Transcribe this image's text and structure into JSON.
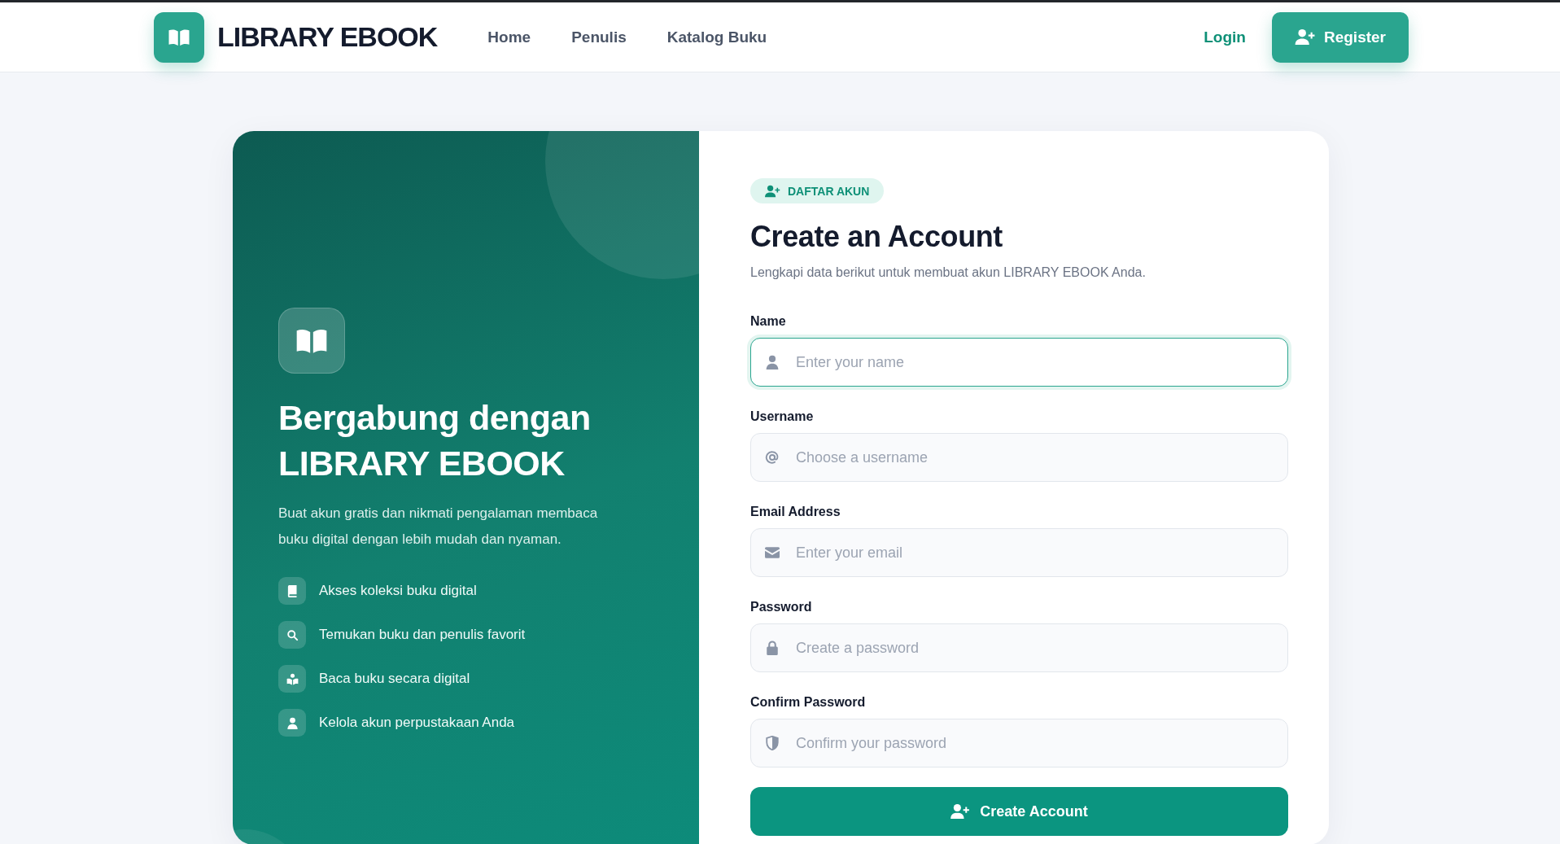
{
  "header": {
    "brand": "LIBRARY EBOOK",
    "nav": [
      "Home",
      "Penulis",
      "Katalog Buku"
    ],
    "login": "Login",
    "register": "Register"
  },
  "promo": {
    "heading": "Bergabung dengan LIBRARY EBOOK",
    "text": "Buat akun gratis dan nikmati pengalaman membaca buku digital dengan lebih mudah dan nyaman.",
    "features": [
      "Akses koleksi buku digital",
      "Temukan buku dan penulis favorit",
      "Baca buku secara digital",
      "Kelola akun perpustakaan Anda"
    ]
  },
  "form": {
    "badge": "DAFTAR AKUN",
    "title": "Create an Account",
    "subtitle": "Lengkapi data berikut untuk membuat akun LIBRARY EBOOK Anda.",
    "fields": [
      {
        "label": "Name",
        "placeholder": "Enter your name",
        "focused": true
      },
      {
        "label": "Username",
        "placeholder": "Choose a username",
        "focused": false
      },
      {
        "label": "Email Address",
        "placeholder": "Enter your email",
        "focused": false
      },
      {
        "label": "Password",
        "placeholder": "Create a password",
        "focused": false
      },
      {
        "label": "Confirm Password",
        "placeholder": "Confirm your password",
        "focused": false
      }
    ],
    "submit": "Create Account"
  }
}
